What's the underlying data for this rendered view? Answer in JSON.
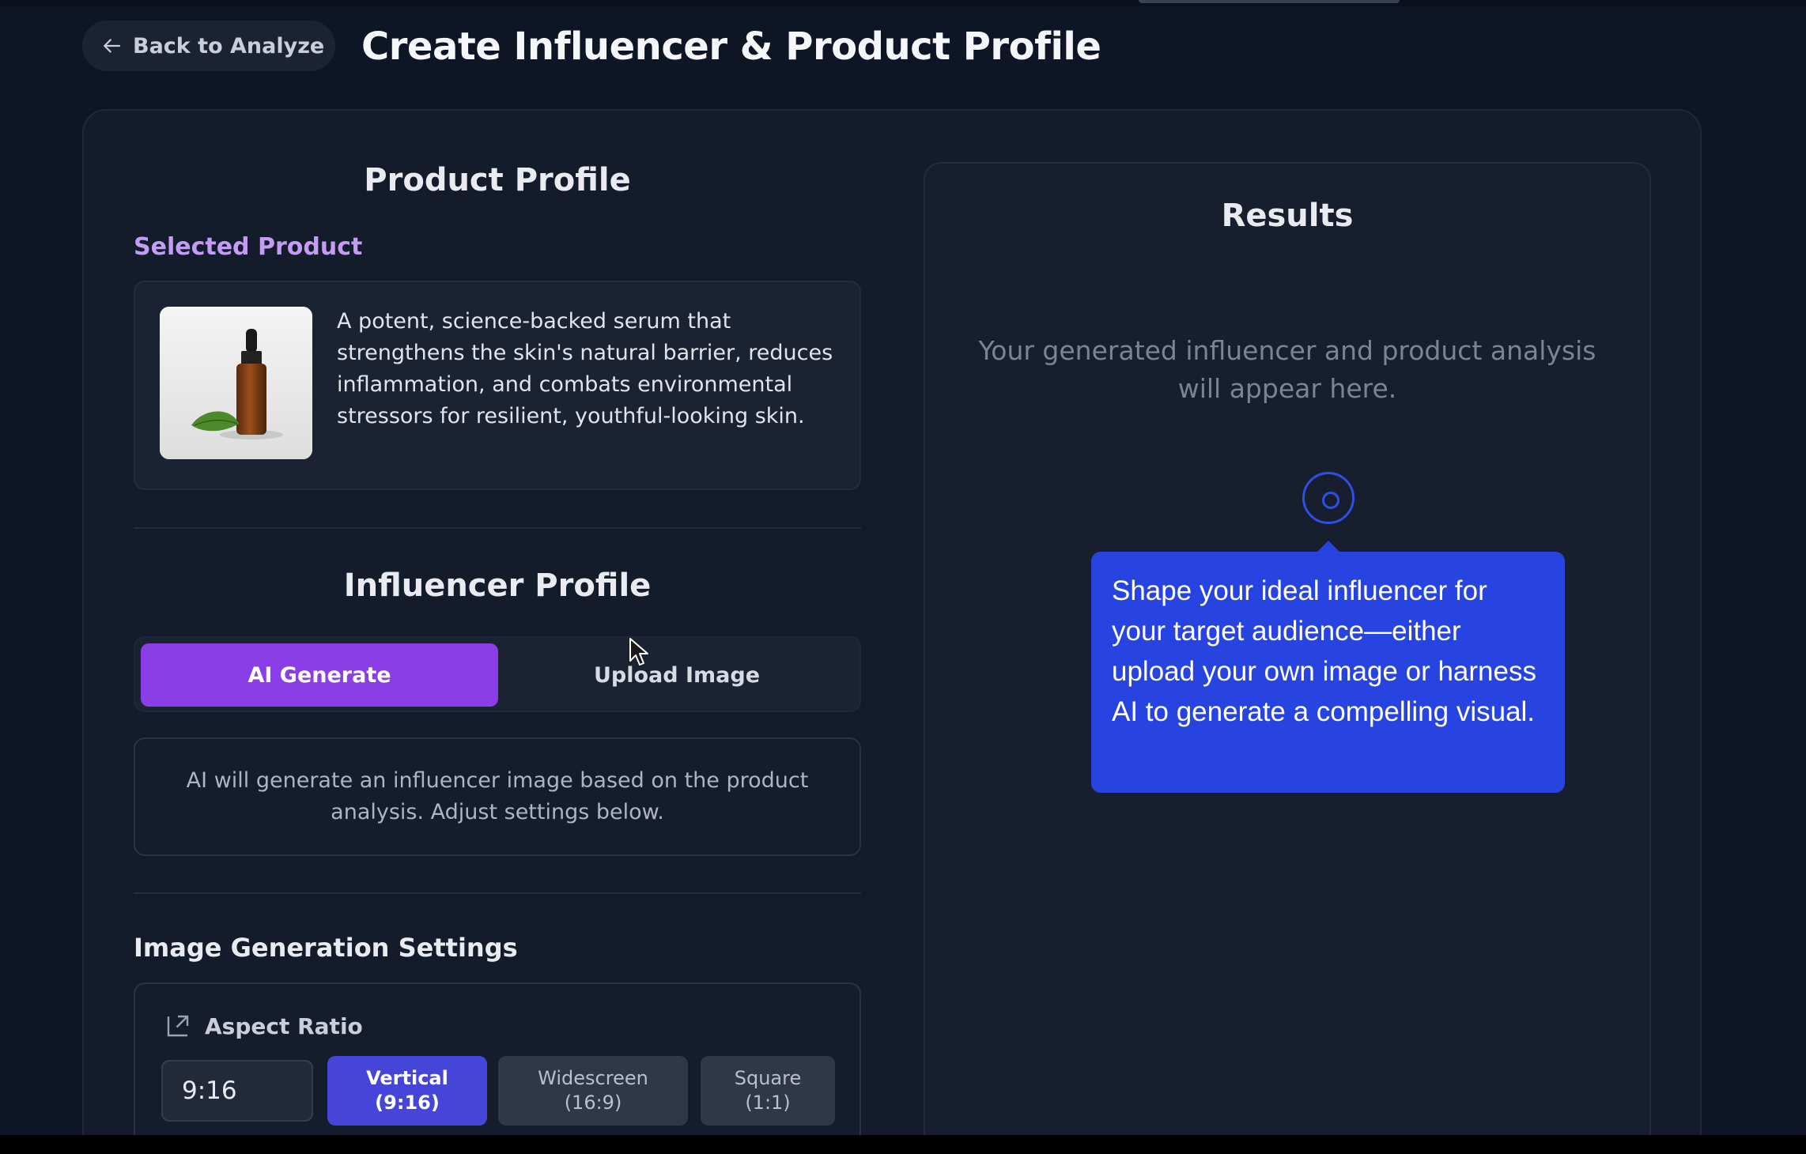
{
  "header": {
    "back_label": "Back to Analyze",
    "title": "Create Influencer & Product Profile"
  },
  "product_profile": {
    "title": "Product Profile",
    "selected_label": "Selected Product",
    "description": "A potent, science-backed serum that strengthens the skin's natural barrier, reduces inflammation, and combats environmental stressors for resilient, youthful-looking skin."
  },
  "influencer_profile": {
    "title": "Influencer Profile",
    "tabs": [
      {
        "label": "AI Generate",
        "active": true
      },
      {
        "label": "Upload Image",
        "active": false
      }
    ],
    "info_text": "AI will generate an influencer image based on the product analysis. Adjust settings below."
  },
  "image_settings": {
    "title": "Image Generation Settings",
    "aspect_ratio_label": "Aspect Ratio",
    "aspect_ratio_value": "9:16",
    "options": [
      {
        "label": "Vertical",
        "ratio": "(9:16)",
        "selected": true
      },
      {
        "label": "Widescreen",
        "ratio": "(16:9)",
        "selected": false
      },
      {
        "label": "Square",
        "ratio": "(1:1)",
        "selected": false
      }
    ]
  },
  "results": {
    "title": "Results",
    "placeholder": "Your generated influencer and product analysis will appear here."
  },
  "tooltip": {
    "text": "Shape your ideal influencer for your target audience—either upload your own image or harness AI to generate a compelling visual."
  },
  "colors": {
    "accent_purple": "#8a3ee6",
    "accent_blue": "#2844e0",
    "selected_label": "#c59cf5"
  }
}
